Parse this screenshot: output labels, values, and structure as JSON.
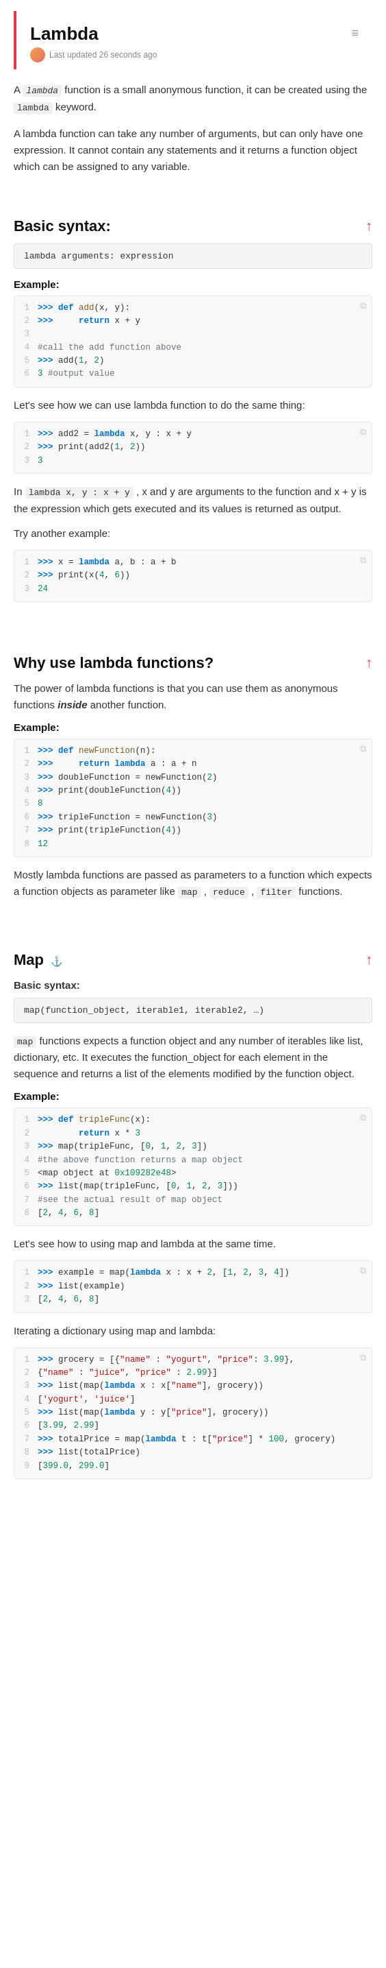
{
  "page": {
    "title": "Lambda",
    "meta_updated": "Last updated 26 seconds ago",
    "menu_icon": "≡"
  },
  "intro": {
    "paragraph1_parts": [
      "A ",
      "lambda",
      " function is a small anonymous function, it can be created using the ",
      "lambda",
      " keyword."
    ],
    "paragraph2": "A lambda function can take any number of arguments, but can only have one expression. It cannot contain any statements and it returns a function object which can be assigned to any variable."
  },
  "sections": [
    {
      "id": "basic-syntax",
      "title": "Basic syntax:",
      "has_anchor": false,
      "syntax": "lambda arguments: expression",
      "example_label": "Example:",
      "code_blocks": [
        {
          "lines": [
            {
              "num": 1,
              "text": ">>> def add(x, y):"
            },
            {
              "num": 2,
              "text": ">>>     return x + y"
            },
            {
              "num": 3,
              "text": ""
            },
            {
              "num": 4,
              "text": "#call the add function above"
            },
            {
              "num": 5,
              "text": ">>> add(1, 2)"
            },
            {
              "num": 6,
              "text": "3 #output value"
            }
          ]
        }
      ],
      "body_texts": [
        "Let's see how we can use lambda function to do the same thing:"
      ],
      "code_blocks2": [
        {
          "lines": [
            {
              "num": 1,
              "text": ">>> add2 = lambda x, y : x + y"
            },
            {
              "num": 2,
              "text": ">>> print(add2(1, 2))"
            },
            {
              "num": 3,
              "text": "3"
            }
          ]
        }
      ],
      "body_texts2": [
        "In lambda x, y : x + y , x and y are arguments to the function and x + y is the expression which gets executed and its values is returned as output.",
        "Try another example:"
      ],
      "code_blocks3": [
        {
          "lines": [
            {
              "num": 1,
              "text": ">>> x = lambda a, b : a + b"
            },
            {
              "num": 2,
              "text": ">>> print(x(4, 6))"
            },
            {
              "num": 3,
              "text": "24"
            }
          ]
        }
      ]
    },
    {
      "id": "why-use",
      "title": "Why use lambda functions?",
      "has_anchor": false,
      "syntax": null,
      "body_texts": [
        "The power of lambda functions is that you can use them as anonymous functions inside another function."
      ],
      "example_label": "Example:",
      "code_blocks": [
        {
          "lines": [
            {
              "num": 1,
              "text": ">>> def newFunction(n):"
            },
            {
              "num": 2,
              "text": ">>>     return lambda a : a + n"
            },
            {
              "num": 3,
              "text": ">>> doubleFunction = newFunction(2)"
            },
            {
              "num": 4,
              "text": ">>> print(doubleFunction(4))"
            },
            {
              "num": 5,
              "text": "8"
            },
            {
              "num": 6,
              "text": ">>> tripleFunction = newFunction(3)"
            },
            {
              "num": 7,
              "text": ">>> print(tripleFunction(4))"
            },
            {
              "num": 8,
              "text": "12"
            }
          ]
        }
      ],
      "body_texts2": [
        "Mostly lambda functions are passed as parameters to a function which expects a function objects as parameter like map , reduce , filter functions."
      ]
    },
    {
      "id": "map",
      "title": "Map",
      "has_anchor": true,
      "syntax": "map(function_object, iterable1, iterable2, …)",
      "body_texts": [
        " map  functions expects a function object and any number of iterables like list, dictionary, etc. It executes the function_object for each element in the sequence and returns a list of the elements modified by the function object."
      ],
      "example_label": "Example:",
      "code_blocks": [
        {
          "lines": [
            {
              "num": 1,
              "text": ">>> def tripleFunc(x):"
            },
            {
              "num": 2,
              "text": "        return x * 3"
            },
            {
              "num": 3,
              "text": ">>> map(tripleFunc, [0, 1, 2, 3])"
            },
            {
              "num": 4,
              "text": "#the above function returns a map object"
            },
            {
              "num": 5,
              "text": "<map object at 0x109282e48>"
            },
            {
              "num": 6,
              "text": ">>> list(map(tripleFunc, [0, 1, 2, 3]))"
            },
            {
              "num": 7,
              "text": "#see the actual result of map object"
            },
            {
              "num": 8,
              "text": "[2, 4, 6, 8]"
            }
          ]
        }
      ],
      "body_texts2": [
        "Let's see how to using map and lambda at the same time."
      ],
      "code_blocks2": [
        {
          "lines": [
            {
              "num": 1,
              "text": ">>> example = map(lambda x : x + 2, [1, 2, 3, 4])"
            },
            {
              "num": 2,
              "text": ">>> list(example)"
            },
            {
              "num": 3,
              "text": "[2, 4, 6, 8]"
            }
          ]
        }
      ],
      "body_texts3": [
        "Iterating a dictionary using map and lambda:"
      ],
      "code_blocks3": [
        {
          "lines": [
            {
              "num": 1,
              "text": ">>> grocery = [{\"name\" : \"yogurt\", \"price\": 3.99},"
            },
            {
              "num": 2,
              "text": "{\"name\" : \"juice\", \"price\" : 2.99}]"
            },
            {
              "num": 3,
              "text": ">>> list(map(lambda x : x[\"name\"], grocery))"
            },
            {
              "num": 4,
              "text": "['yogurt', 'juice']"
            },
            {
              "num": 5,
              "text": ">>> list(map(lambda y : y[\"price\"], grocery))"
            },
            {
              "num": 6,
              "text": "[3.99, 2.99]"
            },
            {
              "num": 7,
              "text": ">>> totalPrice = map(lambda t : t[\"price\"] * 100, grocery)"
            },
            {
              "num": 8,
              "text": ">>> list(totalPrice)"
            },
            {
              "num": 9,
              "text": "[399.0, 299.0]"
            }
          ]
        }
      ]
    }
  ]
}
